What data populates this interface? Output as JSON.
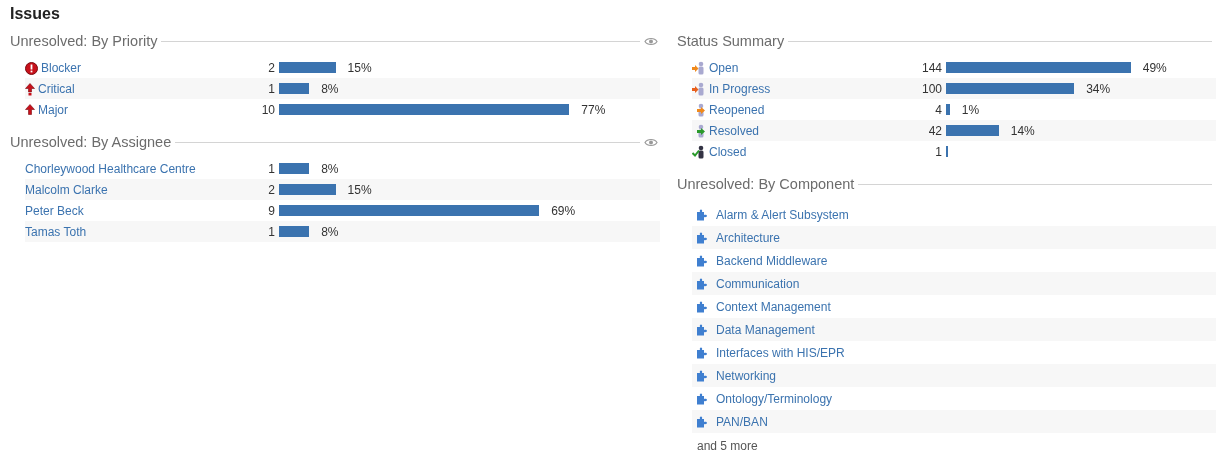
{
  "title": "Issues",
  "left": [
    {
      "title": "Unresolved: By Priority",
      "rows": [
        {
          "kind": "blocker",
          "label": "Blocker",
          "count": "2",
          "pct": "15%"
        },
        {
          "kind": "critical",
          "label": "Critical",
          "count": "1",
          "pct": "8%"
        },
        {
          "kind": "major",
          "label": "Major",
          "count": "10",
          "pct": "77%"
        }
      ]
    },
    {
      "title": "Unresolved: By Assignee",
      "rows": [
        {
          "label": "Chorleywood Healthcare Centre",
          "count": "1",
          "pct": "8%"
        },
        {
          "label": "Malcolm Clarke",
          "count": "2",
          "pct": "15%"
        },
        {
          "label": "Peter Beck",
          "count": "9",
          "pct": "69%"
        },
        {
          "label": "Tamas Toth",
          "count": "1",
          "pct": "8%"
        }
      ]
    }
  ],
  "status": {
    "title": "Status Summary",
    "rows": [
      {
        "kind": "open",
        "label": "Open",
        "count": "144",
        "pct": "49%"
      },
      {
        "kind": "in_progress",
        "label": "In Progress",
        "count": "100",
        "pct": "34%"
      },
      {
        "kind": "reopened",
        "label": "Reopened",
        "count": "4",
        "pct": "1%"
      },
      {
        "kind": "resolved",
        "label": "Resolved",
        "count": "42",
        "pct": "14%"
      },
      {
        "kind": "closed",
        "label": "Closed",
        "count": "1"
      }
    ]
  },
  "components": {
    "title": "Unresolved: By Component",
    "items": [
      "Alarm & Alert Subsystem",
      "Architecture",
      "Backend Middleware",
      "Communication",
      "Context Management",
      "Data Management",
      "Interfaces with HIS/EPR",
      "Networking",
      "Ontology/Terminology",
      "PAN/BAN"
    ],
    "more": "and 5 more"
  }
}
